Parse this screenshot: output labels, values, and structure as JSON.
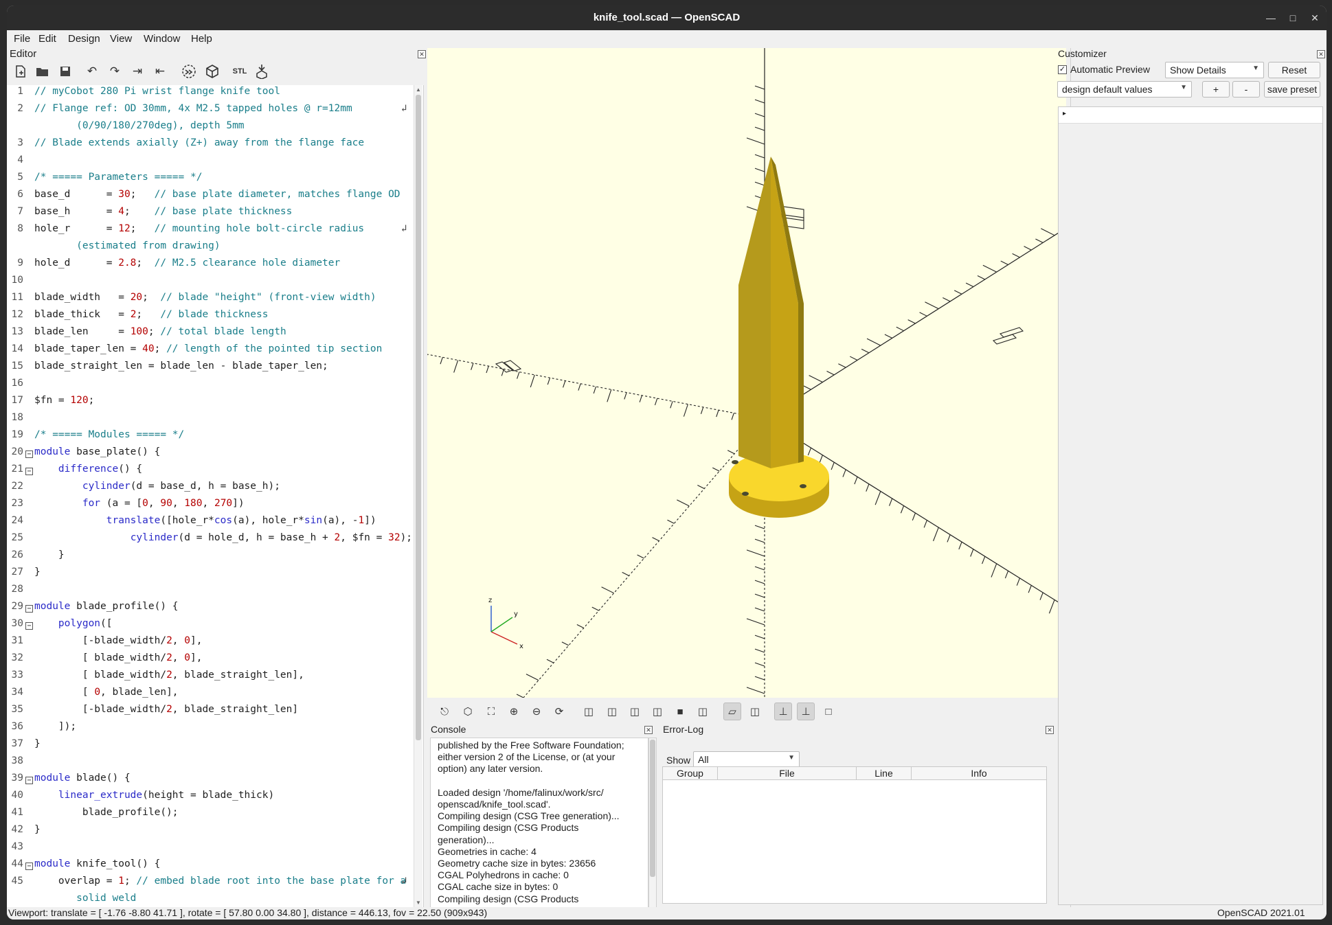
{
  "window": {
    "title": "knife_tool.scad — OpenSCAD"
  },
  "menu": [
    "File",
    "Edit",
    "Design",
    "View",
    "Window",
    "Help"
  ],
  "editor": {
    "title": "Editor",
    "toolbar_icons": [
      "new-file-icon",
      "open-file-icon",
      "save-icon",
      "undo-icon",
      "redo-icon",
      "indent-icon",
      "unindent-icon",
      "preview-icon",
      "render-icon",
      "export-stl-icon",
      "send-to-print-icon"
    ],
    "lines": [
      {
        "n": "1",
        "parts": [
          {
            "t": "// myCobot 280 Pi wrist flange knife tool",
            "c": "c-cmt"
          }
        ]
      },
      {
        "n": "2",
        "parts": [
          {
            "t": "// Flange ref: OD 30mm, 4x M2.5 tapped holes @ r=12mm",
            "c": "c-cmt"
          }
        ],
        "wrap": true
      },
      {
        "n": "",
        "parts": [
          {
            "t": "       (0/90/180/270deg), depth 5mm",
            "c": "c-cmt"
          }
        ]
      },
      {
        "n": "3",
        "parts": [
          {
            "t": "// Blade extends axially (Z+) away from the flange face",
            "c": "c-cmt"
          }
        ]
      },
      {
        "n": "4",
        "parts": []
      },
      {
        "n": "5",
        "parts": [
          {
            "t": "/* ===== Parameters ===== */",
            "c": "c-cmt"
          }
        ]
      },
      {
        "n": "6",
        "parts": [
          {
            "t": "base_d      = ",
            "c": ""
          },
          {
            "t": "30",
            "c": "c-num"
          },
          {
            "t": ";   ",
            "c": ""
          },
          {
            "t": "// base plate diameter, matches flange OD",
            "c": "c-cmt"
          }
        ]
      },
      {
        "n": "7",
        "parts": [
          {
            "t": "base_h      = ",
            "c": ""
          },
          {
            "t": "4",
            "c": "c-num"
          },
          {
            "t": ";    ",
            "c": ""
          },
          {
            "t": "// base plate thickness",
            "c": "c-cmt"
          }
        ]
      },
      {
        "n": "8",
        "parts": [
          {
            "t": "hole_r      = ",
            "c": ""
          },
          {
            "t": "12",
            "c": "c-num"
          },
          {
            "t": ";   ",
            "c": ""
          },
          {
            "t": "// mounting hole bolt-circle radius",
            "c": "c-cmt"
          }
        ],
        "wrap": true
      },
      {
        "n": "",
        "parts": [
          {
            "t": "       (estimated from drawing)",
            "c": "c-cmt"
          }
        ]
      },
      {
        "n": "9",
        "parts": [
          {
            "t": "hole_d      = ",
            "c": ""
          },
          {
            "t": "2.8",
            "c": "c-num"
          },
          {
            "t": ";  ",
            "c": ""
          },
          {
            "t": "// M2.5 clearance hole diameter",
            "c": "c-cmt"
          }
        ]
      },
      {
        "n": "10",
        "parts": []
      },
      {
        "n": "11",
        "parts": [
          {
            "t": "blade_width   = ",
            "c": ""
          },
          {
            "t": "20",
            "c": "c-num"
          },
          {
            "t": ";  ",
            "c": ""
          },
          {
            "t": "// blade \"height\" (front-view width)",
            "c": "c-cmt"
          }
        ]
      },
      {
        "n": "12",
        "parts": [
          {
            "t": "blade_thick   = ",
            "c": ""
          },
          {
            "t": "2",
            "c": "c-num"
          },
          {
            "t": ";   ",
            "c": ""
          },
          {
            "t": "// blade thickness",
            "c": "c-cmt"
          }
        ]
      },
      {
        "n": "13",
        "parts": [
          {
            "t": "blade_len     = ",
            "c": ""
          },
          {
            "t": "100",
            "c": "c-num"
          },
          {
            "t": "; ",
            "c": ""
          },
          {
            "t": "// total blade length",
            "c": "c-cmt"
          }
        ]
      },
      {
        "n": "14",
        "parts": [
          {
            "t": "blade_taper_len = ",
            "c": ""
          },
          {
            "t": "40",
            "c": "c-num"
          },
          {
            "t": "; ",
            "c": ""
          },
          {
            "t": "// length of the pointed tip section",
            "c": "c-cmt"
          }
        ]
      },
      {
        "n": "15",
        "parts": [
          {
            "t": "blade_straight_len = blade_len - blade_taper_len;",
            "c": ""
          }
        ]
      },
      {
        "n": "16",
        "parts": []
      },
      {
        "n": "17",
        "parts": [
          {
            "t": "$fn = ",
            "c": ""
          },
          {
            "t": "120",
            "c": "c-num"
          },
          {
            "t": ";",
            "c": ""
          }
        ]
      },
      {
        "n": "18",
        "parts": []
      },
      {
        "n": "19",
        "parts": [
          {
            "t": "/* ===== Modules ===== */",
            "c": "c-cmt"
          }
        ]
      },
      {
        "n": "20",
        "fold": true,
        "parts": [
          {
            "t": "module ",
            "c": "c-kw"
          },
          {
            "t": "base_plate() {",
            "c": ""
          }
        ]
      },
      {
        "n": "21",
        "fold": true,
        "parts": [
          {
            "t": "    ",
            "c": ""
          },
          {
            "t": "difference",
            "c": "c-mod"
          },
          {
            "t": "() {",
            "c": ""
          }
        ]
      },
      {
        "n": "22",
        "parts": [
          {
            "t": "        ",
            "c": ""
          },
          {
            "t": "cylinder",
            "c": "c-mod"
          },
          {
            "t": "(d = base_d, h = base_h);",
            "c": ""
          }
        ]
      },
      {
        "n": "23",
        "parts": [
          {
            "t": "        ",
            "c": ""
          },
          {
            "t": "for",
            "c": "c-kw"
          },
          {
            "t": " (a = [",
            "c": ""
          },
          {
            "t": "0",
            "c": "c-num"
          },
          {
            "t": ", ",
            "c": ""
          },
          {
            "t": "90",
            "c": "c-num"
          },
          {
            "t": ", ",
            "c": ""
          },
          {
            "t": "180",
            "c": "c-num"
          },
          {
            "t": ", ",
            "c": ""
          },
          {
            "t": "270",
            "c": "c-num"
          },
          {
            "t": "])",
            "c": ""
          }
        ]
      },
      {
        "n": "24",
        "parts": [
          {
            "t": "            ",
            "c": ""
          },
          {
            "t": "translate",
            "c": "c-mod"
          },
          {
            "t": "([hole_r*",
            "c": ""
          },
          {
            "t": "cos",
            "c": "c-mod"
          },
          {
            "t": "(a), hole_r*",
            "c": ""
          },
          {
            "t": "sin",
            "c": "c-mod"
          },
          {
            "t": "(a), -",
            "c": ""
          },
          {
            "t": "1",
            "c": "c-num"
          },
          {
            "t": "])",
            "c": ""
          }
        ]
      },
      {
        "n": "25",
        "parts": [
          {
            "t": "                ",
            "c": ""
          },
          {
            "t": "cylinder",
            "c": "c-mod"
          },
          {
            "t": "(d = hole_d, h = base_h + ",
            "c": ""
          },
          {
            "t": "2",
            "c": "c-num"
          },
          {
            "t": ", $fn = ",
            "c": ""
          },
          {
            "t": "32",
            "c": "c-num"
          },
          {
            "t": ");",
            "c": ""
          }
        ]
      },
      {
        "n": "26",
        "parts": [
          {
            "t": "    }",
            "c": ""
          }
        ]
      },
      {
        "n": "27",
        "parts": [
          {
            "t": "}",
            "c": ""
          }
        ]
      },
      {
        "n": "28",
        "parts": []
      },
      {
        "n": "29",
        "fold": true,
        "parts": [
          {
            "t": "module ",
            "c": "c-kw"
          },
          {
            "t": "blade_profile() {",
            "c": ""
          }
        ]
      },
      {
        "n": "30",
        "fold": true,
        "parts": [
          {
            "t": "    ",
            "c": ""
          },
          {
            "t": "polygon",
            "c": "c-mod"
          },
          {
            "t": "([",
            "c": ""
          }
        ]
      },
      {
        "n": "31",
        "parts": [
          {
            "t": "        [-blade_width/",
            "c": ""
          },
          {
            "t": "2",
            "c": "c-num"
          },
          {
            "t": ", ",
            "c": ""
          },
          {
            "t": "0",
            "c": "c-num"
          },
          {
            "t": "],",
            "c": ""
          }
        ]
      },
      {
        "n": "32",
        "parts": [
          {
            "t": "        [ blade_width/",
            "c": ""
          },
          {
            "t": "2",
            "c": "c-num"
          },
          {
            "t": ", ",
            "c": ""
          },
          {
            "t": "0",
            "c": "c-num"
          },
          {
            "t": "],",
            "c": ""
          }
        ]
      },
      {
        "n": "33",
        "parts": [
          {
            "t": "        [ blade_width/",
            "c": ""
          },
          {
            "t": "2",
            "c": "c-num"
          },
          {
            "t": ", blade_straight_len],",
            "c": ""
          }
        ]
      },
      {
        "n": "34",
        "parts": [
          {
            "t": "        [ ",
            "c": ""
          },
          {
            "t": "0",
            "c": "c-num"
          },
          {
            "t": ", blade_len],",
            "c": ""
          }
        ]
      },
      {
        "n": "35",
        "parts": [
          {
            "t": "        [-blade_width/",
            "c": ""
          },
          {
            "t": "2",
            "c": "c-num"
          },
          {
            "t": ", blade_straight_len]",
            "c": ""
          }
        ]
      },
      {
        "n": "36",
        "parts": [
          {
            "t": "    ]);",
            "c": ""
          }
        ]
      },
      {
        "n": "37",
        "parts": [
          {
            "t": "}",
            "c": ""
          }
        ]
      },
      {
        "n": "38",
        "parts": []
      },
      {
        "n": "39",
        "fold": true,
        "parts": [
          {
            "t": "module ",
            "c": "c-kw"
          },
          {
            "t": "blade() {",
            "c": ""
          }
        ]
      },
      {
        "n": "40",
        "parts": [
          {
            "t": "    ",
            "c": ""
          },
          {
            "t": "linear_extrude",
            "c": "c-mod"
          },
          {
            "t": "(height = blade_thick)",
            "c": ""
          }
        ]
      },
      {
        "n": "41",
        "parts": [
          {
            "t": "        blade_profile();",
            "c": ""
          }
        ]
      },
      {
        "n": "42",
        "parts": [
          {
            "t": "}",
            "c": ""
          }
        ]
      },
      {
        "n": "43",
        "parts": []
      },
      {
        "n": "44",
        "fold": true,
        "parts": [
          {
            "t": "module ",
            "c": "c-kw"
          },
          {
            "t": "knife_tool() {",
            "c": ""
          }
        ]
      },
      {
        "n": "45",
        "parts": [
          {
            "t": "    overlap = ",
            "c": ""
          },
          {
            "t": "1",
            "c": "c-num"
          },
          {
            "t": "; ",
            "c": ""
          },
          {
            "t": "// embed blade root into the base plate for a",
            "c": "c-cmt"
          }
        ],
        "wrap": true
      },
      {
        "n": "",
        "parts": [
          {
            "t": "       solid weld",
            "c": "c-cmt"
          }
        ]
      }
    ]
  },
  "viewport_toolbar_icons": [
    "preview-icon",
    "render-icon",
    "view-all-icon",
    "zoom-in-icon",
    "zoom-out-icon",
    "reset-view-icon",
    "view-right-icon",
    "view-top-icon",
    "view-bottom-icon",
    "view-left-icon",
    "view-front-icon",
    "view-back-icon",
    "perspective-icon",
    "orthogonal-icon",
    "show-axes-icon",
    "show-scale-icon",
    "show-edges-icon"
  ],
  "axis_labels": {
    "x": "x",
    "y": "y",
    "z": "z"
  },
  "console": {
    "title": "Console",
    "lines": [
      "published by the Free Software Foundation;",
      "either version 2 of the License, or (at your",
      "option) any later version.",
      "",
      "Loaded design '/home/falinux/work/src/",
      "openscad/knife_tool.scad'.",
      "Compiling design (CSG Tree generation)...",
      "Compiling design (CSG Products",
      "generation)...",
      "Geometries in cache: 4",
      "Geometry cache size in bytes: 23656",
      "CGAL Polyhedrons in cache: 0",
      "CGAL cache size in bytes: 0",
      "Compiling design (CSG Products"
    ]
  },
  "errorlog": {
    "title": "Error-Log",
    "show_label": "Show",
    "show_value": "All",
    "columns": [
      "Group",
      "File",
      "Line",
      "Info"
    ]
  },
  "customizer": {
    "title": "Customizer",
    "auto_preview_label": "Automatic Preview",
    "auto_preview_checked": true,
    "details_value": "Show Details",
    "reset_label": "Reset",
    "preset_value": "design default values",
    "plus_label": "+",
    "minus_label": "-",
    "save_preset_label": "save preset"
  },
  "status": {
    "left": "Viewport: translate = [ -1.76 -8.80 41.71 ], rotate = [ 57.80 0.00 34.80 ], distance = 446.13, fov = 22.50 (909x943)",
    "right": "OpenSCAD 2021.01"
  },
  "colors": {
    "viewport_bg": "#ffffe5",
    "model": "#f9d72c",
    "model_shade": "#c6a315"
  }
}
